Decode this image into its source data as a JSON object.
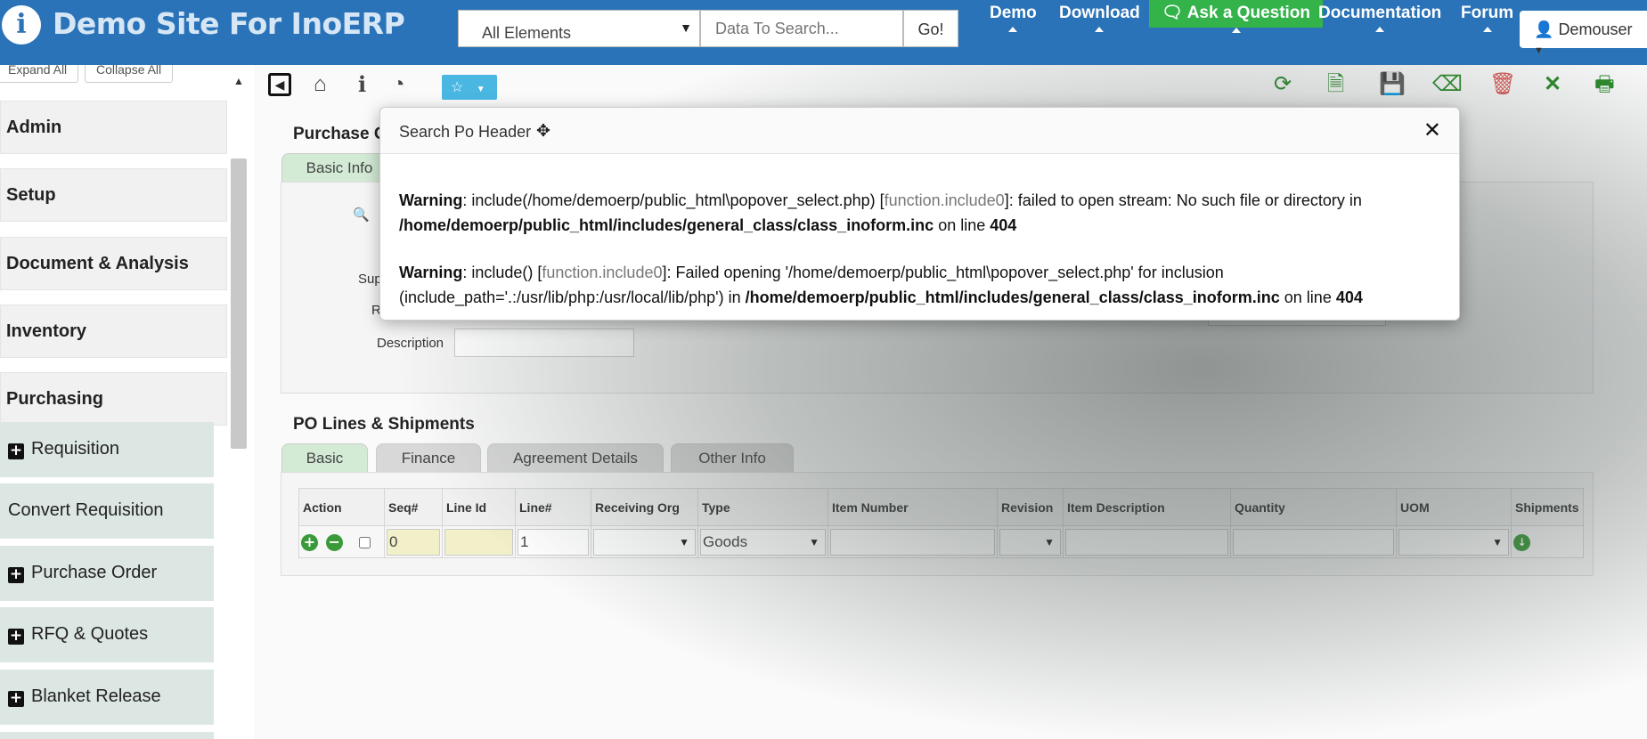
{
  "header": {
    "logo_letter": "i",
    "site_title": "Demo Site For InoERP",
    "search_select": "All Elements",
    "search_placeholder": "Data To Search...",
    "go_label": "Go!",
    "nav": [
      "Demo",
      "Download",
      "Ask a Question",
      "Documentation",
      "Forum"
    ],
    "user_label": "Demouser"
  },
  "sidebar": {
    "expand_all": "Expand All",
    "collapse_all": "Collapse All",
    "menus": [
      "Admin",
      "Setup",
      "Document & Analysis",
      "Inventory",
      "Purchasing"
    ],
    "sub_items": [
      "Requisition",
      "Convert Requisition",
      "Purchase Order",
      "RFQ & Quotes",
      "Blanket Release"
    ]
  },
  "main": {
    "section_title": "Purchase O",
    "header_tab": "Basic Info",
    "labels": {
      "supplier": "Sup",
      "r": "R",
      "description": "Description"
    },
    "lines_title": "PO Lines & Shipments",
    "line_tabs": [
      "Basic",
      "Finance",
      "Agreement Details",
      "Other Info"
    ],
    "columns": [
      "Action",
      "Seq#",
      "Line Id",
      "Line#",
      "Receiving Org",
      "Type",
      "Item Number",
      "Revision",
      "Item Description",
      "Quantity",
      "UOM",
      "Shipments"
    ],
    "row": {
      "seq": "0",
      "line_id": "",
      "line_num": "1",
      "receiving_org": "",
      "type": "Goods",
      "item_number": "",
      "revision": "",
      "item_description": "",
      "quantity": "",
      "uom": ""
    }
  },
  "modal": {
    "title": "Search Po Header",
    "warning_1": {
      "label": "Warning",
      "text_a": ": include(/home/demoerp/public_html\\popover_select.php) [",
      "fn": "function.include0",
      "text_b": "]: failed to open stream: No such file or directory in",
      "path": "/home/demoerp/public_html/includes/general_class/class_inoform.inc",
      "on_line": " on line ",
      "line": "404"
    },
    "warning_2": {
      "label": "Warning",
      "text_a": ": include() [",
      "fn": "function.include0",
      "text_b": "]: Failed opening '/home/demoerp/public_html\\popover_select.php' for inclusion",
      "text_c": "(include_path='.:/usr/lib/php:/usr/local/lib/php') in ",
      "path": "/home/demoerp/public_html/includes/general_class/class_inoform.inc",
      "on_line": " on line ",
      "line": "404"
    }
  },
  "colors": {
    "navbar": "#2a73b8",
    "ask_button": "#34b34a",
    "favorite_button": "#4ab7e3",
    "active_tab": "#d3ead5",
    "sub_menu_bg": "#dce7e3"
  }
}
